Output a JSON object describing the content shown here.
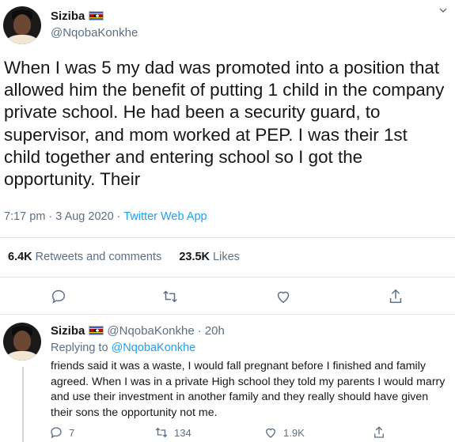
{
  "main_tweet": {
    "display_name": "Siziba",
    "flag_icon": "eswatini-flag-icon",
    "handle": "@NqobaKonkhe",
    "text": "When I was 5 my dad was promoted into a position that allowed him the benefit of putting 1 child in the company private school. He had been a security guard, to supervisor, and mom worked at PEP. I was their 1st child together and entering school so I got the opportunity. Their",
    "time": "7:17 pm · 3 Aug 2020 · ",
    "app": "Twitter Web App",
    "retweets_count": "6.4K",
    "retweets_label": "Retweets and comments",
    "likes_count": "23.5K",
    "likes_label": "Likes"
  },
  "reply_tweet": {
    "display_name": "Siziba",
    "handle": "@NqobaKonkhe",
    "time": "20h",
    "replying_to_label": "Replying to",
    "replying_to_handle": "@NqobaKonkhe",
    "text": "friends said it was a waste, I would fall pregnant before I finished and family agreed. When I was in a private High school they told my parents I would marry and use their investment in another family and they really should have given their sons the opportunity not me.",
    "reply_count": "7",
    "retweet_count": "134",
    "like_count": "1.9K"
  },
  "colors": {
    "accent": "#1da1f2",
    "secondary_text": "#5b7083",
    "divider": "#e1e8ed"
  }
}
